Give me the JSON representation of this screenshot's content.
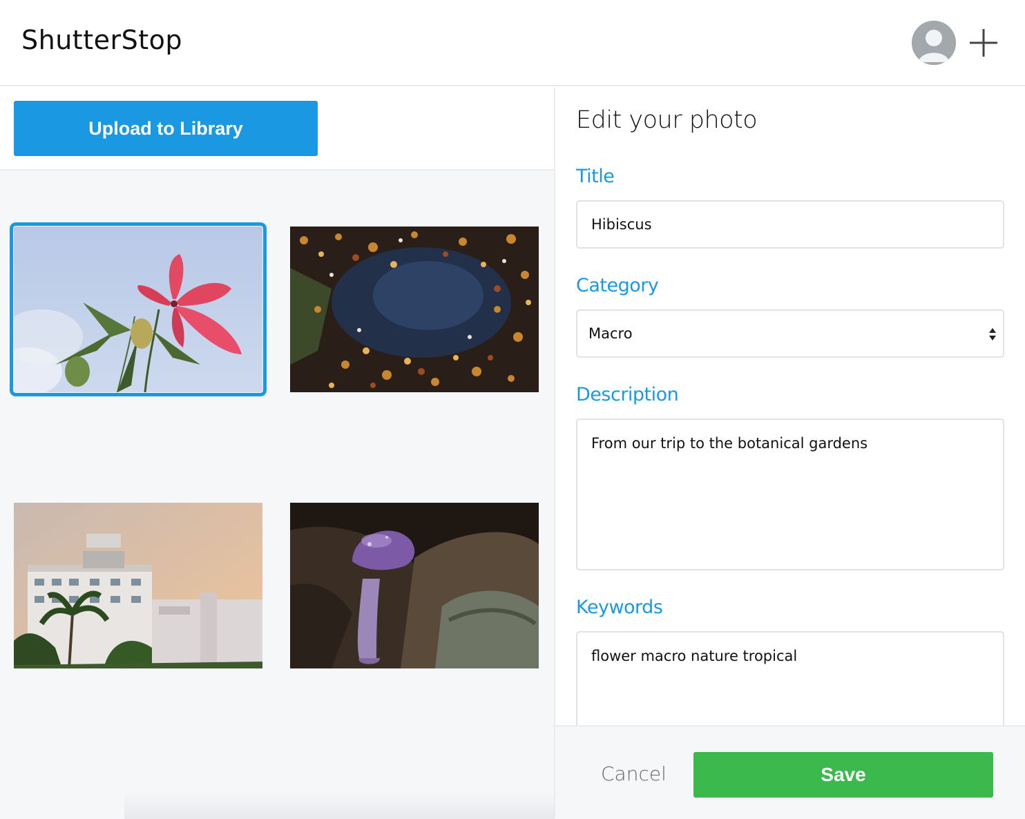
{
  "app": {
    "brand": "ShutterStop"
  },
  "header": {
    "avatar_icon": "user-avatar-icon",
    "add_icon": "plus-icon"
  },
  "library": {
    "upload_label": "Upload to Library",
    "photos": [
      {
        "subject": "red hibiscus flower against sky",
        "selected": true
      },
      {
        "subject": "autumn leaves floating in puddle",
        "selected": false
      },
      {
        "subject": "art deco hotel building with palm trees",
        "selected": false
      },
      {
        "subject": "purple mushroom on log",
        "selected": false
      }
    ]
  },
  "editor": {
    "heading": "Edit your photo",
    "title_label": "Title",
    "title_value": "Hibiscus",
    "category_label": "Category",
    "category_value": "Macro",
    "description_label": "Description",
    "description_value": "From our trip to the botanical gardens",
    "keywords_label": "Keywords",
    "keywords_value": "flower macro nature tropical",
    "cancel_label": "Cancel",
    "save_label": "Save"
  },
  "colors": {
    "accent": "#1a99e2",
    "save": "#3bb94d",
    "panel_bg": "#f6f7f9"
  }
}
